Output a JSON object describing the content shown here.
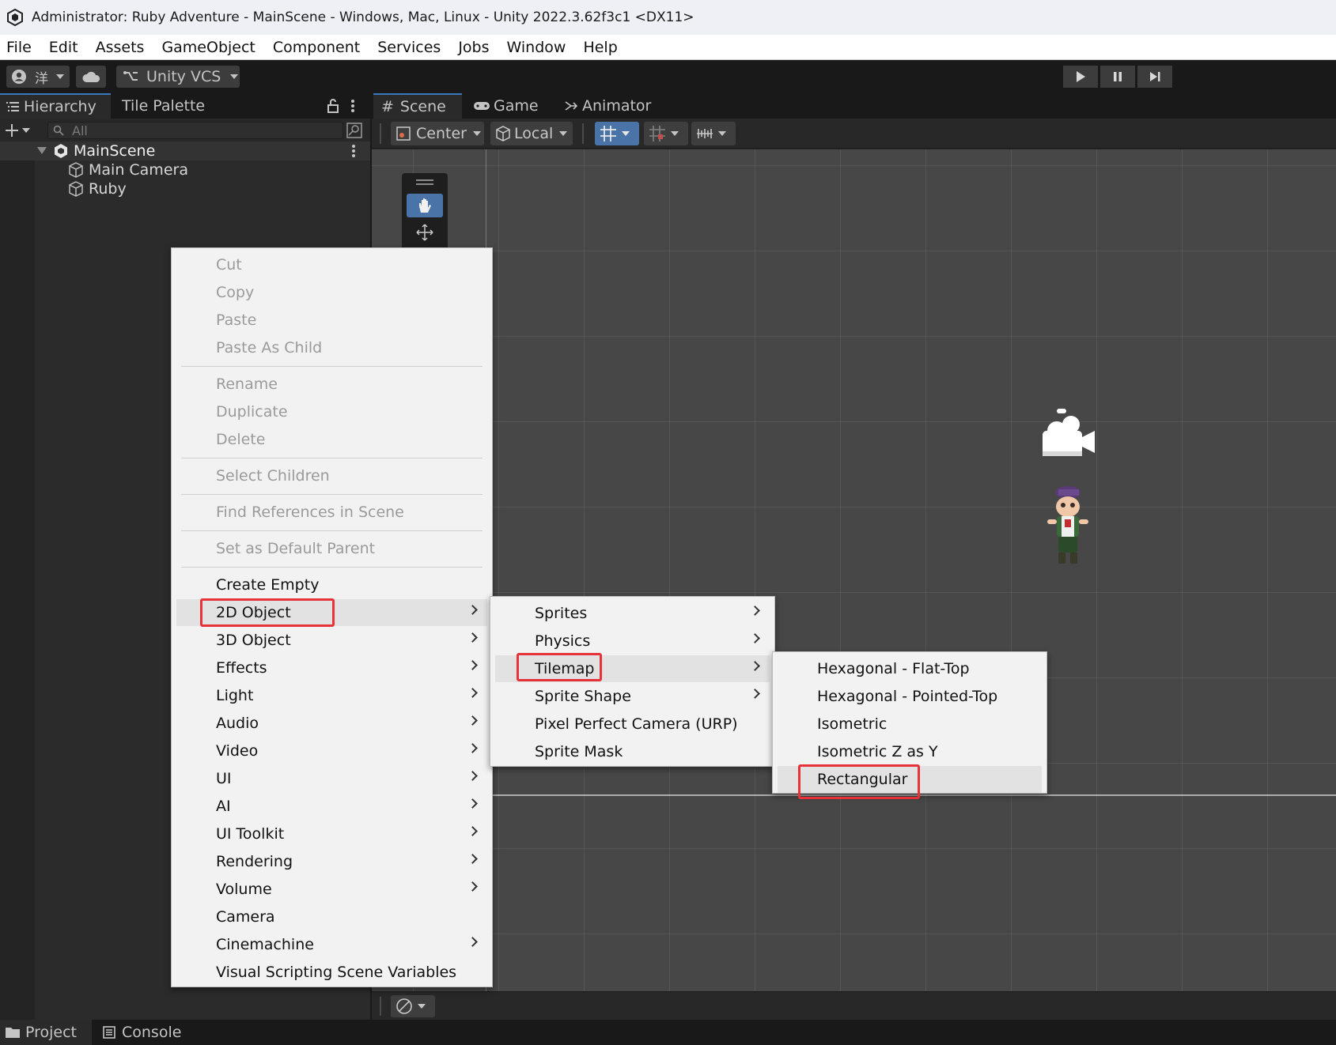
{
  "window": {
    "title": "Administrator: Ruby Adventure - MainScene - Windows, Mac, Linux - Unity 2022.3.62f3c1 <DX11>"
  },
  "menubar": [
    "File",
    "Edit",
    "Assets",
    "GameObject",
    "Component",
    "Services",
    "Jobs",
    "Window",
    "Help"
  ],
  "toolbar": {
    "account_label": "洋",
    "vcs_label": "Unity VCS"
  },
  "hierarchy": {
    "tabs": [
      "Hierarchy",
      "Tile Palette"
    ],
    "search_placeholder": "All",
    "scene_name": "MainScene",
    "items": [
      "Main Camera",
      "Ruby"
    ]
  },
  "scene": {
    "tabs": [
      "Scene",
      "Game",
      "Animator"
    ],
    "pivot_mode": "Center",
    "pivot_rotation": "Local"
  },
  "bottom_tabs": [
    "Project",
    "Console"
  ],
  "context_menu": {
    "groups": [
      [
        {
          "label": "Cut",
          "enabled": false
        },
        {
          "label": "Copy",
          "enabled": false
        },
        {
          "label": "Paste",
          "enabled": false
        },
        {
          "label": "Paste As Child",
          "enabled": false
        }
      ],
      [
        {
          "label": "Rename",
          "enabled": false
        },
        {
          "label": "Duplicate",
          "enabled": false
        },
        {
          "label": "Delete",
          "enabled": false
        }
      ],
      [
        {
          "label": "Select Children",
          "enabled": false
        }
      ],
      [
        {
          "label": "Find References in Scene",
          "enabled": false
        }
      ],
      [
        {
          "label": "Set as Default Parent",
          "enabled": false
        }
      ]
    ],
    "create_items": [
      {
        "label": "Create Empty",
        "submenu": false
      },
      {
        "label": "2D Object",
        "submenu": true,
        "active": true
      },
      {
        "label": "3D Object",
        "submenu": true
      },
      {
        "label": "Effects",
        "submenu": true
      },
      {
        "label": "Light",
        "submenu": true
      },
      {
        "label": "Audio",
        "submenu": true
      },
      {
        "label": "Video",
        "submenu": true
      },
      {
        "label": "UI",
        "submenu": true
      },
      {
        "label": "AI",
        "submenu": true
      },
      {
        "label": "UI Toolkit",
        "submenu": true
      },
      {
        "label": "Rendering",
        "submenu": true
      },
      {
        "label": "Volume",
        "submenu": true
      },
      {
        "label": "Camera",
        "submenu": false
      },
      {
        "label": "Cinemachine",
        "submenu": true
      },
      {
        "label": "Visual Scripting Scene Variables",
        "submenu": false
      }
    ]
  },
  "submenu_2d": [
    {
      "label": "Sprites",
      "submenu": true
    },
    {
      "label": "Physics",
      "submenu": true
    },
    {
      "label": "Tilemap",
      "submenu": true,
      "active": true
    },
    {
      "label": "Sprite Shape",
      "submenu": true
    },
    {
      "label": "Pixel Perfect Camera (URP)",
      "submenu": false
    },
    {
      "label": "Sprite Mask",
      "submenu": false
    }
  ],
  "submenu_tilemap": [
    {
      "label": "Hexagonal - Flat-Top"
    },
    {
      "label": "Hexagonal - Pointed-Top"
    },
    {
      "label": "Isometric"
    },
    {
      "label": "Isometric Z as Y"
    },
    {
      "label": "Rectangular",
      "active": true
    }
  ],
  "colors": {
    "highlight": "#e8323a",
    "selected_tool": "#4a73a8"
  }
}
